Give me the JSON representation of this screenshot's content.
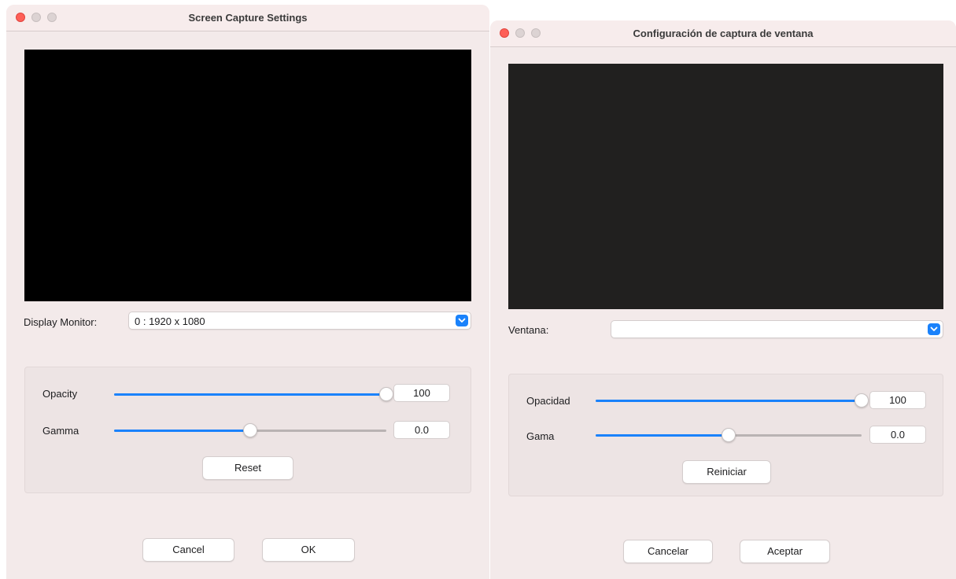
{
  "screen_capture": {
    "title": "Screen Capture Settings",
    "display_monitor_label": "Display Monitor:",
    "display_monitor_value": "0 : 1920 x 1080",
    "opacity_label": "Opacity",
    "opacity_value": "100",
    "opacity_level": 1.0,
    "gamma_label": "Gamma",
    "gamma_value": "0.0",
    "gamma_level": 0.5,
    "reset_label": "Reset",
    "cancel_label": "Cancel",
    "ok_label": "OK",
    "preview_color": "#000000"
  },
  "window_capture": {
    "title": "Configuración de captura de ventana",
    "window_label": "Ventana:",
    "window_value": "",
    "opacity_label": "Opacidad",
    "opacity_value": "100",
    "opacity_level": 1.0,
    "gamma_label": "Gama",
    "gamma_value": "0.0",
    "gamma_level": 0.5,
    "reset_label": "Reiniciar",
    "cancel_label": "Cancelar",
    "ok_label": "Aceptar",
    "preview_color": "#21201f"
  },
  "colors": {
    "accent": "#1a82fb",
    "window_bg": "#f3eaea",
    "close_light": "#fe5f57"
  },
  "icons": {
    "close": "close-traffic-light-icon",
    "minimize": "minimize-traffic-light-icon",
    "zoom": "zoom-traffic-light-icon",
    "dropdown": "chevron-down-icon"
  }
}
